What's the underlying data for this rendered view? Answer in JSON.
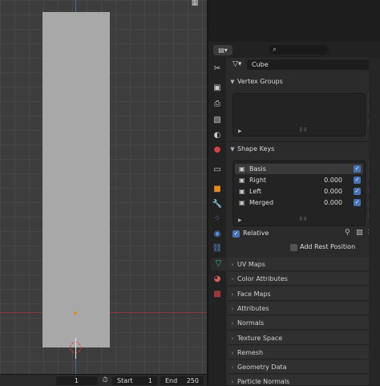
{
  "timeline": {
    "current_frame": "1",
    "start_label": "Start",
    "start_value": "1",
    "end_label": "End",
    "end_value": "250"
  },
  "properties": {
    "object_name": "Cube",
    "vertex_groups": {
      "title": "Vertex Groups"
    },
    "shape_keys": {
      "title": "Shape Keys",
      "keys": [
        {
          "name": "Basis",
          "value": "",
          "checked": true
        },
        {
          "name": "Right",
          "value": "0.000",
          "checked": true
        },
        {
          "name": "Left",
          "value": "0.000",
          "checked": true
        },
        {
          "name": "Merged",
          "value": "0.000",
          "checked": true
        }
      ],
      "relative_label": "Relative",
      "add_rest_label": "Add Rest Position"
    },
    "panels": [
      "UV Maps",
      "Color Attributes",
      "Face Maps",
      "Attributes",
      "Normals",
      "Texture Space",
      "Remesh",
      "Geometry Data",
      "Particle Normals"
    ]
  },
  "colors": {
    "accent": "#4772b3",
    "active_tab_icon": "#2fb87a",
    "origin": "#e08a20"
  },
  "icons": {
    "tabs": [
      "tool-icon",
      "render-icon",
      "output-icon",
      "view-layer-icon",
      "scene-icon",
      "world-icon",
      "collection-icon",
      "object-icon",
      "modifier-icon",
      "particles-icon",
      "physics-icon",
      "constraints-icon",
      "mesh-data-icon",
      "material-icon",
      "texture-icon"
    ]
  }
}
